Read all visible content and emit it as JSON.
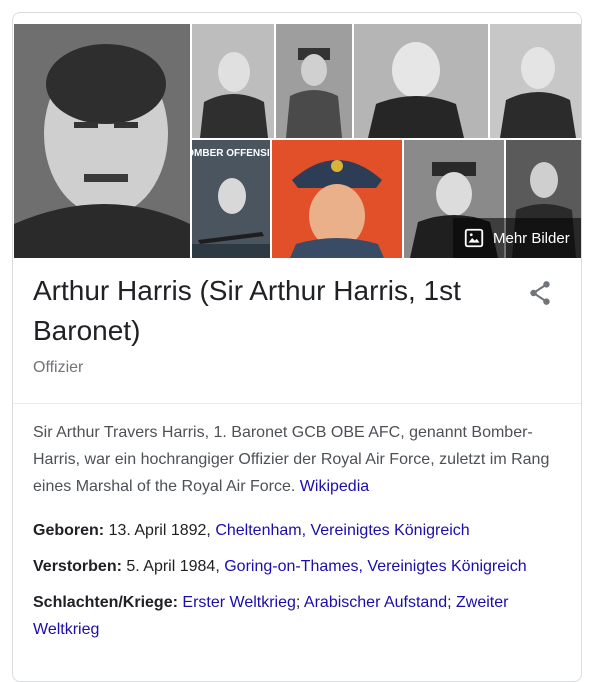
{
  "knowledge_panel": {
    "more_images_label": "Mehr Bilder",
    "title": "Arthur Harris (Sir Arthur Harris, 1st Baronet)",
    "subtitle": "Offizier",
    "description": "Sir Arthur Travers Harris, 1. Baronet GCB OBE AFC, genannt Bomber-Harris, war ein hochrangiger Offizier der Royal Air Force, zuletzt im Rang eines Marshal of the Royal Air Force.",
    "source_link": "Wikipedia",
    "poster_text": "BOMBER OFFENSIVE",
    "facts": [
      {
        "label": "Geboren:",
        "prefix": "13. April 1892,",
        "links": [
          "Cheltenham, Vereinigtes Königreich"
        ]
      },
      {
        "label": "Verstorben:",
        "prefix": "5. April 1984,",
        "links": [
          "Goring-on-Thames, Vereinigtes Königreich"
        ]
      },
      {
        "label": "Schlachten/Kriege:",
        "prefix": "",
        "links": [
          "Erster Weltkrieg",
          "Arabischer Aufstand",
          "Zweiter Weltkrieg"
        ]
      }
    ]
  },
  "colors": {
    "link": "#1a0dab",
    "text": "#202124",
    "muted": "#70757a",
    "border": "#dadce0"
  },
  "icons": {
    "more_images": "image-icon",
    "share": "share-icon"
  }
}
